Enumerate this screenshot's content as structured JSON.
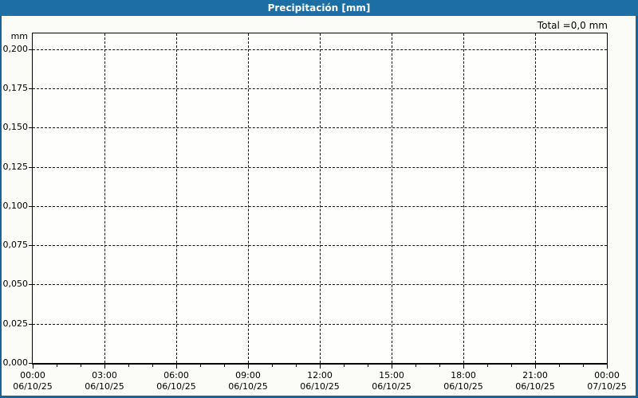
{
  "window": {
    "background": "#FBFCF8",
    "border_color": "#1B6396"
  },
  "title_bar": {
    "title": "Precipitación [mm]",
    "background": "#1C6EA4",
    "text_color": "#FFFFFF"
  },
  "total_label": "Total =0,0 mm",
  "chart_data": {
    "type": "line",
    "title": "Precipitación [mm]",
    "xlabel": "",
    "ylabel": "mm",
    "ylim": [
      0,
      0.21
    ],
    "xlim_hours": [
      0,
      24
    ],
    "grid": true,
    "grid_style": "dashed",
    "legend_position": "none",
    "y_ticks": [
      {
        "value": 0.2,
        "label": "0,200"
      },
      {
        "value": 0.175,
        "label": "0,175"
      },
      {
        "value": 0.15,
        "label": "0,150"
      },
      {
        "value": 0.125,
        "label": "0,125"
      },
      {
        "value": 0.1,
        "label": "0,100"
      },
      {
        "value": 0.075,
        "label": "0,075"
      },
      {
        "value": 0.05,
        "label": "0,050"
      },
      {
        "value": 0.025,
        "label": "0,025"
      },
      {
        "value": 0.0,
        "label": "0,000"
      }
    ],
    "x_ticks_major": [
      {
        "hour": 0,
        "time": "00:00",
        "date": "06/10/25"
      },
      {
        "hour": 3,
        "time": "03:00",
        "date": "06/10/25"
      },
      {
        "hour": 6,
        "time": "06:00",
        "date": "06/10/25"
      },
      {
        "hour": 9,
        "time": "09:00",
        "date": "06/10/25"
      },
      {
        "hour": 12,
        "time": "12:00",
        "date": "06/10/25"
      },
      {
        "hour": 15,
        "time": "15:00",
        "date": "06/10/25"
      },
      {
        "hour": 18,
        "time": "18:00",
        "date": "06/10/25"
      },
      {
        "hour": 21,
        "time": "21:00",
        "date": "06/10/25"
      },
      {
        "hour": 24,
        "time": "00:00",
        "date": "07/10/25"
      }
    ],
    "x_minor_tick_hours": 1,
    "series": [
      {
        "name": "Precipitación",
        "values": [],
        "total_mm": 0.0
      }
    ],
    "total_annotation": "Total =0,0 mm"
  }
}
